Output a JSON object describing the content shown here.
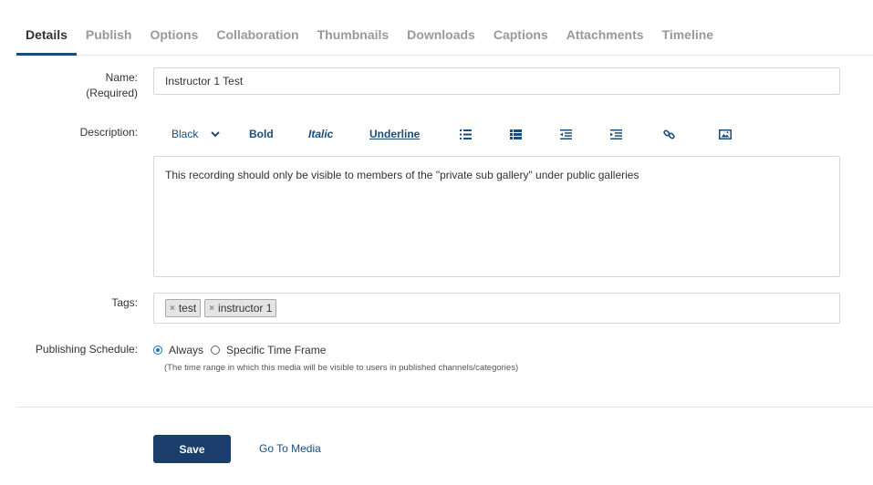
{
  "tabs": [
    {
      "label": "Details",
      "active": true
    },
    {
      "label": "Publish"
    },
    {
      "label": "Options"
    },
    {
      "label": "Collaboration"
    },
    {
      "label": "Thumbnails"
    },
    {
      "label": "Downloads"
    },
    {
      "label": "Captions"
    },
    {
      "label": "Attachments"
    },
    {
      "label": "Timeline"
    }
  ],
  "form": {
    "name_label": "Name:",
    "name_required": "(Required)",
    "name_value": "Instructor 1 Test",
    "description_label": "Description:",
    "description_text": "This recording should only be visible to members of the \"private sub gallery\" under public galleries",
    "tags_label": "Tags:",
    "tags": [
      "test",
      "instructor 1"
    ],
    "tag_remove_glyph": "×",
    "schedule_label": "Publishing Schedule:",
    "schedule_options": [
      "Always",
      "Specific Time Frame"
    ],
    "schedule_selected": "Always",
    "schedule_note": "(The time range in which this media will be visible to users in published channels/categories)"
  },
  "toolbar": {
    "color_select": "Black",
    "bold": "Bold",
    "italic": "Italic",
    "underline": "Underline",
    "icons": [
      "bulleted-list-icon",
      "numbered-list-icon",
      "outdent-icon",
      "indent-icon",
      "link-icon",
      "image-icon"
    ]
  },
  "actions": {
    "save": "Save",
    "go_to_media": "Go To Media"
  },
  "colors": {
    "accent": "#1a4d7c",
    "save_button": "#1a3d6b",
    "radio": "#1a6fc9"
  }
}
